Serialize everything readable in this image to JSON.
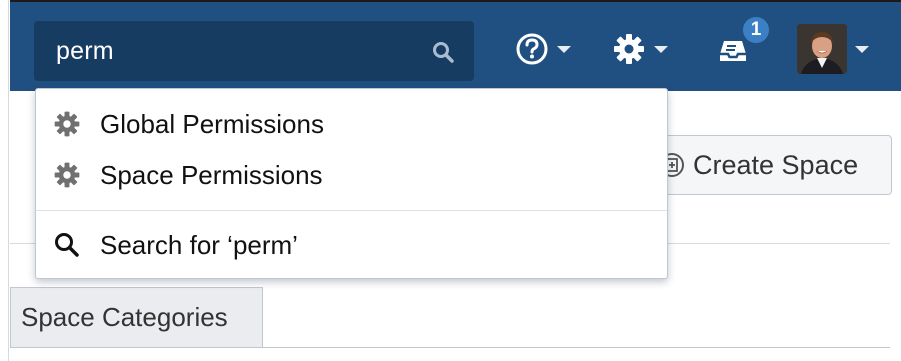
{
  "header": {
    "search": {
      "value": "perm"
    },
    "notification_count": "1"
  },
  "dropdown": {
    "items": [
      {
        "label": "Global Permissions",
        "icon": "gear-icon"
      },
      {
        "label": "Space Permissions",
        "icon": "gear-icon"
      }
    ],
    "search_label": "Search for ‘perm’"
  },
  "page": {
    "create_space_label": "Create Space",
    "tab_label": "Space Categories"
  },
  "colors": {
    "header_bg": "#205081",
    "search_bg": "#173c62",
    "badge_bg": "#3b7fc4"
  }
}
